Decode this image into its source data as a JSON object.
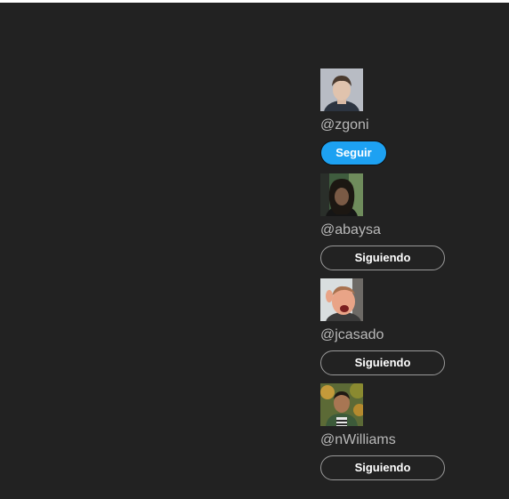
{
  "colors": {
    "background": "#222222",
    "handle_text": "#b9b9b9",
    "follow_button": "#1da1f2",
    "following_border": "#9a9a9a"
  },
  "users": [
    {
      "handle": "@zgoni",
      "button_label": "Seguir",
      "state": "not-following"
    },
    {
      "handle": "@abaysa",
      "button_label": "Siguiendo",
      "state": "following"
    },
    {
      "handle": "@jcasado",
      "button_label": "Siguiendo",
      "state": "following"
    },
    {
      "handle": "@nWilliams",
      "button_label": "Siguiendo",
      "state": "following"
    }
  ]
}
